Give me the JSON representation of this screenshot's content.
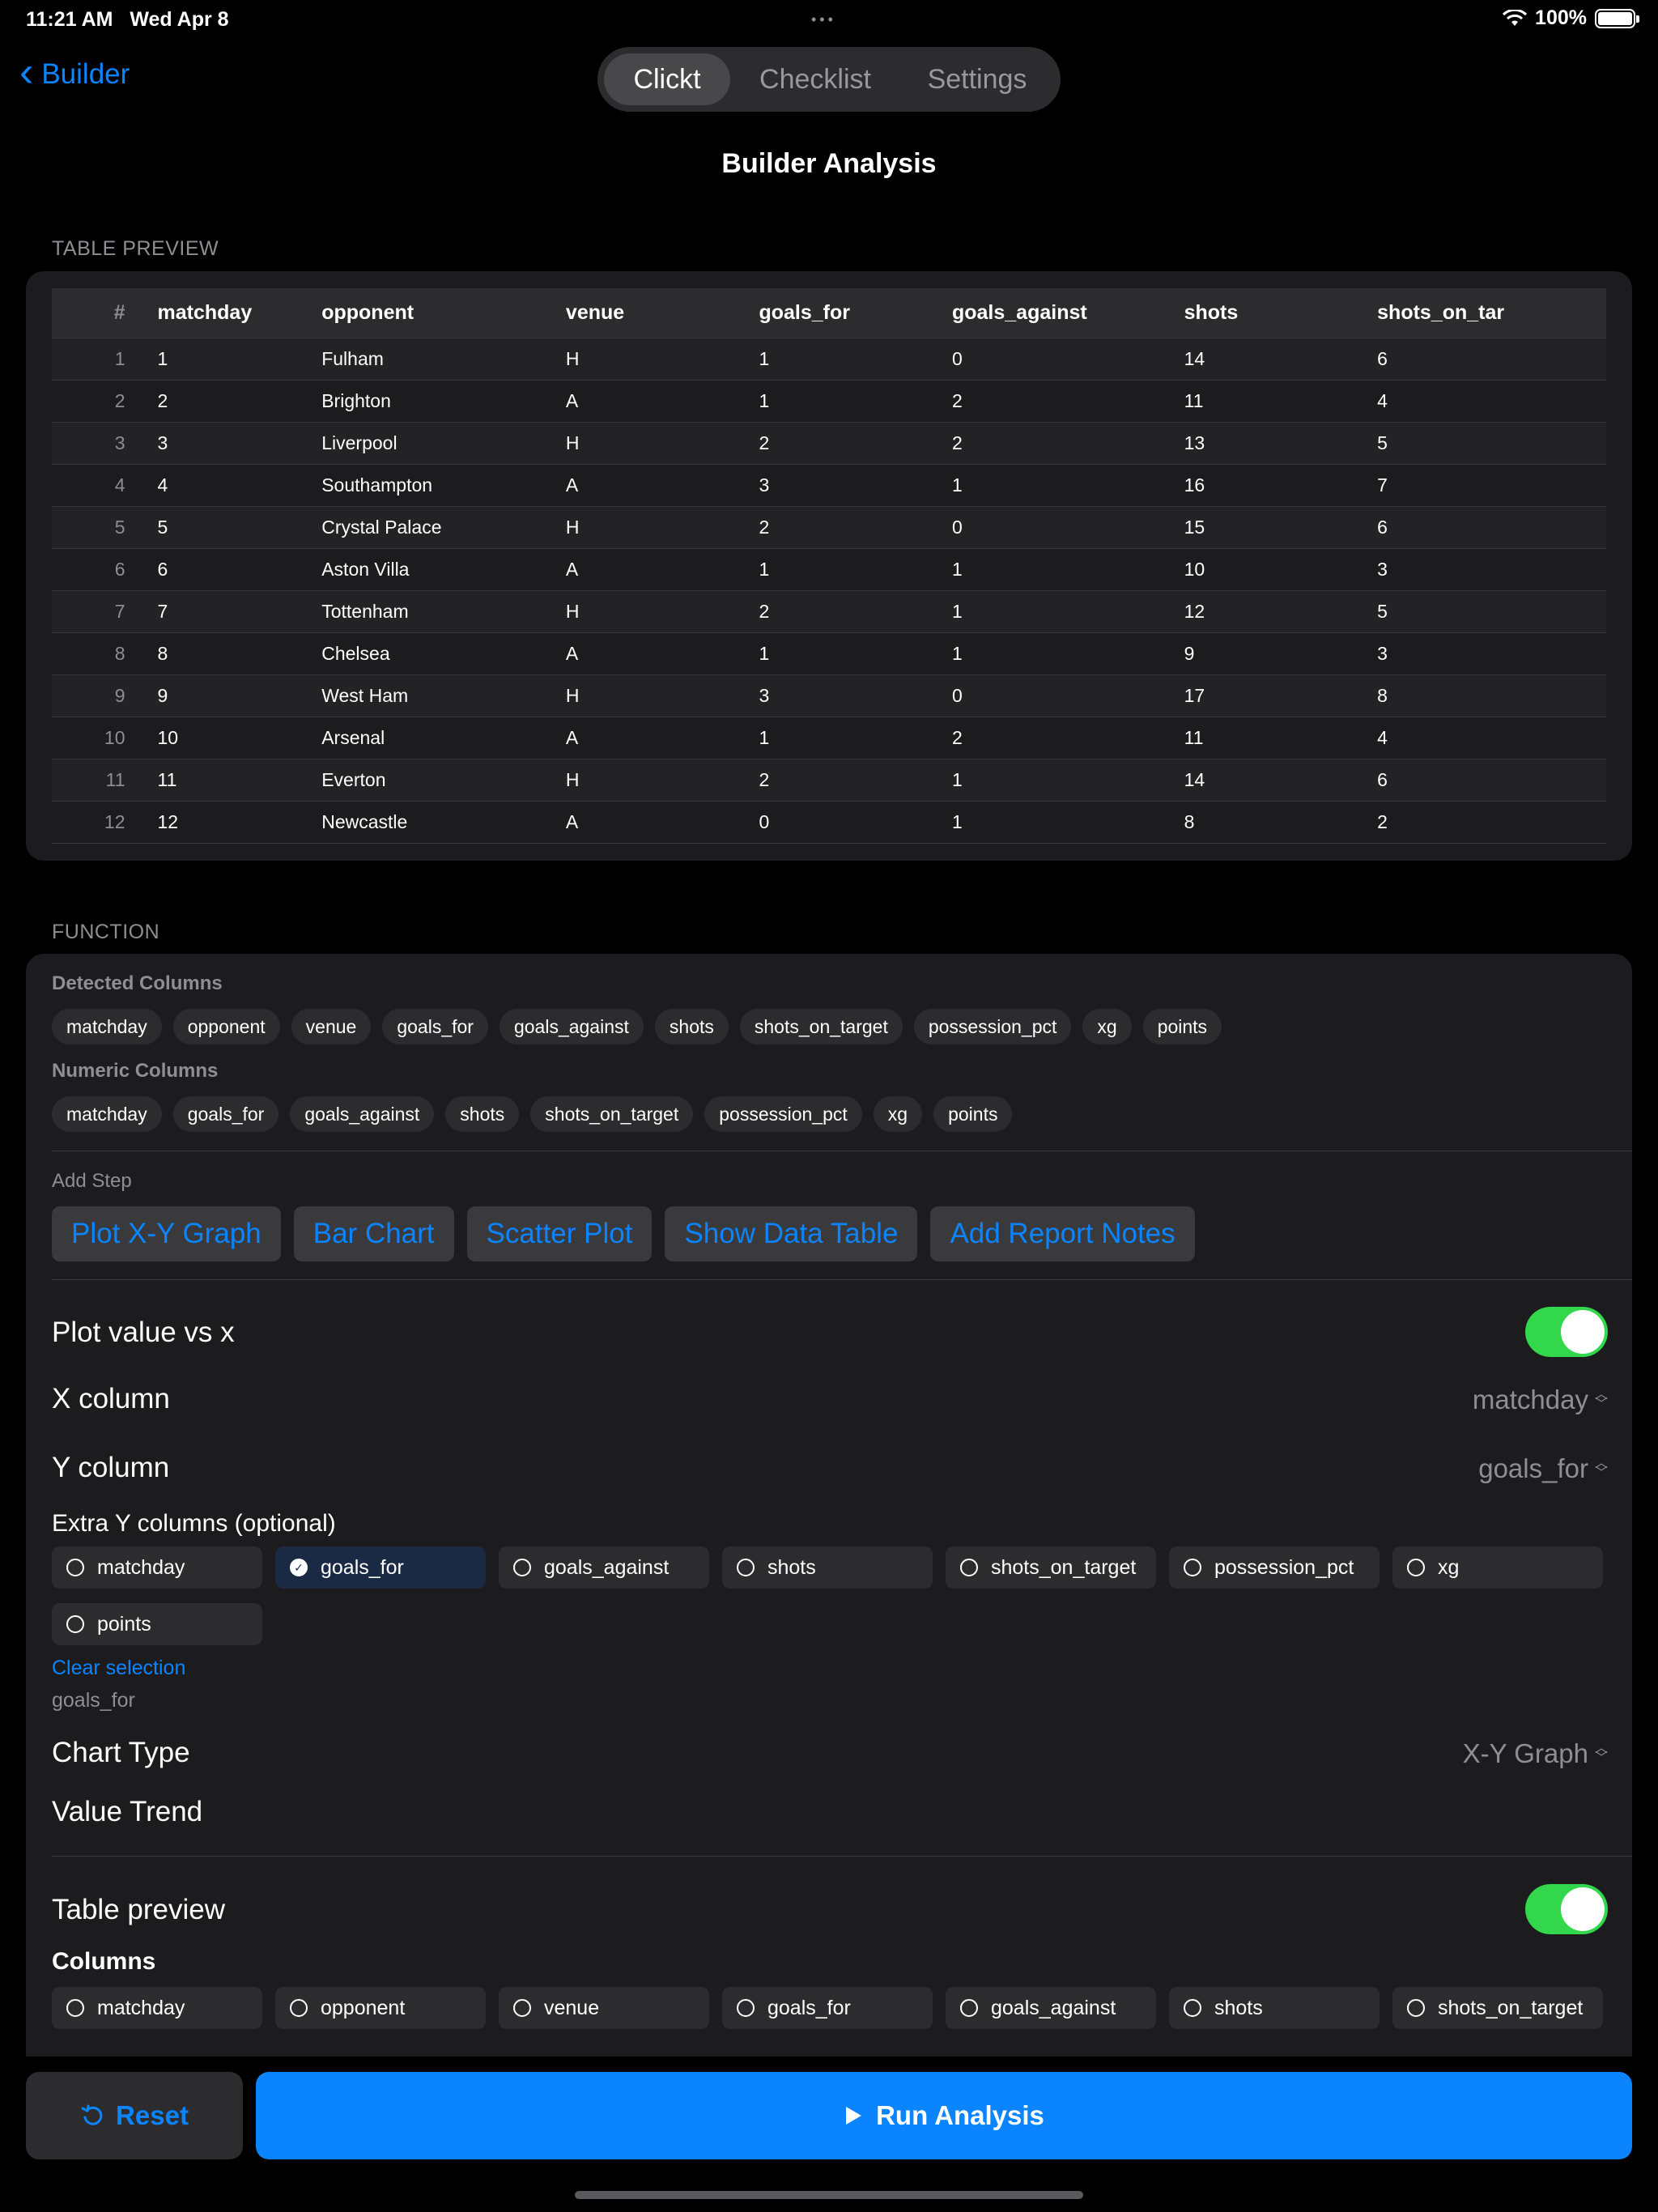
{
  "status": {
    "time": "11:21 AM",
    "date": "Wed Apr 8",
    "battery": "100%",
    "battery_level": 1.0
  },
  "nav": {
    "back_label": "Builder",
    "tabs": [
      {
        "label": "Clickt",
        "active": true
      },
      {
        "label": "Checklist",
        "active": false
      },
      {
        "label": "Settings",
        "active": false
      }
    ],
    "title": "Builder Analysis"
  },
  "table_preview": {
    "header": "TABLE PREVIEW",
    "columns": [
      "#",
      "matchday",
      "opponent",
      "venue",
      "goals_for",
      "goals_against",
      "shots",
      "shots_on_tar"
    ],
    "rows": [
      [
        "1",
        "1",
        "Fulham",
        "H",
        "1",
        "0",
        "14",
        "6"
      ],
      [
        "2",
        "2",
        "Brighton",
        "A",
        "1",
        "2",
        "11",
        "4"
      ],
      [
        "3",
        "3",
        "Liverpool",
        "H",
        "2",
        "2",
        "13",
        "5"
      ],
      [
        "4",
        "4",
        "Southampton",
        "A",
        "3",
        "1",
        "16",
        "7"
      ],
      [
        "5",
        "5",
        "Crystal Palace",
        "H",
        "2",
        "0",
        "15",
        "6"
      ],
      [
        "6",
        "6",
        "Aston Villa",
        "A",
        "1",
        "1",
        "10",
        "3"
      ],
      [
        "7",
        "7",
        "Tottenham",
        "H",
        "2",
        "1",
        "12",
        "5"
      ],
      [
        "8",
        "8",
        "Chelsea",
        "A",
        "1",
        "1",
        "9",
        "3"
      ],
      [
        "9",
        "9",
        "West Ham",
        "H",
        "3",
        "0",
        "17",
        "8"
      ],
      [
        "10",
        "10",
        "Arsenal",
        "A",
        "1",
        "2",
        "11",
        "4"
      ],
      [
        "11",
        "11",
        "Everton",
        "H",
        "2",
        "1",
        "14",
        "6"
      ],
      [
        "12",
        "12",
        "Newcastle",
        "A",
        "0",
        "1",
        "8",
        "2"
      ]
    ]
  },
  "function": {
    "header": "FUNCTION",
    "detected_label": "Detected Columns",
    "detected_columns": [
      "matchday",
      "opponent",
      "venue",
      "goals_for",
      "goals_against",
      "shots",
      "shots_on_target",
      "possession_pct",
      "xg",
      "points"
    ],
    "numeric_label": "Numeric Columns",
    "numeric_columns": [
      "matchday",
      "goals_for",
      "goals_against",
      "shots",
      "shots_on_target",
      "possession_pct",
      "xg",
      "points"
    ],
    "add_step_label": "Add Step",
    "steps": [
      "Plot X-Y Graph",
      "Bar Chart",
      "Scatter Plot",
      "Show Data Table",
      "Add Report Notes"
    ]
  },
  "plot": {
    "title": "Plot value vs x",
    "enabled": true,
    "x_label": "X column",
    "x_value": "matchday",
    "y_label": "Y column",
    "y_value": "goals_for",
    "extra_label": "Extra Y columns (optional)",
    "extra_options": [
      {
        "label": "matchday",
        "selected": false
      },
      {
        "label": "goals_for",
        "selected": true
      },
      {
        "label": "goals_against",
        "selected": false
      },
      {
        "label": "shots",
        "selected": false
      },
      {
        "label": "shots_on_target",
        "selected": false
      },
      {
        "label": "possession_pct",
        "selected": false
      },
      {
        "label": "xg",
        "selected": false
      },
      {
        "label": "points",
        "selected": false
      }
    ],
    "clear_label": "Clear selection",
    "selected_summary": "goals_for",
    "chart_type_label": "Chart Type",
    "chart_type_value": "X-Y Graph",
    "chart_title": "Value Trend"
  },
  "table_step": {
    "title": "Table preview",
    "enabled": true,
    "columns_label": "Columns",
    "column_options": [
      {
        "label": "matchday",
        "selected": false
      },
      {
        "label": "opponent",
        "selected": false
      },
      {
        "label": "venue",
        "selected": false
      },
      {
        "label": "goals_for",
        "selected": false
      },
      {
        "label": "goals_against",
        "selected": false
      },
      {
        "label": "shots",
        "selected": false
      },
      {
        "label": "shots_on_target",
        "selected": false
      }
    ]
  },
  "actions": {
    "reset_label": "Reset",
    "run_label": "Run Analysis"
  },
  "colors": {
    "accent": "#0a84ff",
    "toggle_on": "#32d74b",
    "card": "#1c1c1e",
    "background": "#000000"
  }
}
